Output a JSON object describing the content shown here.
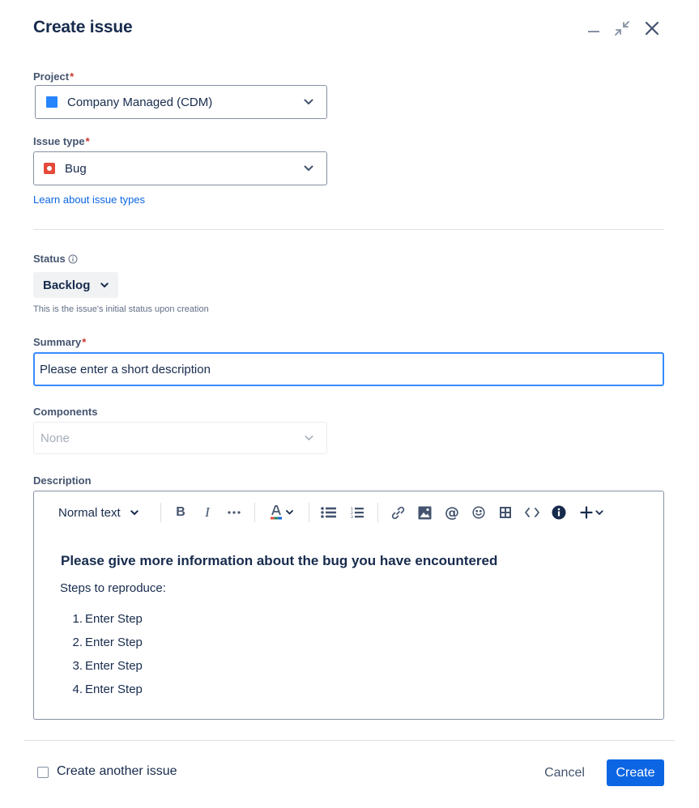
{
  "dialog": {
    "title": "Create issue",
    "header_icons": [
      "minimize-icon",
      "shrink-icon",
      "close-icon"
    ]
  },
  "project": {
    "label": "Project",
    "required_mark": "*",
    "value": "Company Managed (CDM)",
    "icon_color": "#2684ff"
  },
  "issue_type": {
    "label": "Issue type",
    "required_mark": "*",
    "value": "Bug",
    "icon_color": "#e5493a",
    "learn_link": "Learn about issue types"
  },
  "status": {
    "label": "Status",
    "value": "Backlog",
    "helper": "This is the issue's initial status upon creation"
  },
  "summary": {
    "label": "Summary",
    "required_mark": "*",
    "value": "Please enter a short description"
  },
  "components": {
    "label": "Components",
    "value": "None"
  },
  "description": {
    "label": "Description",
    "toolbar": {
      "text_style": "Normal text",
      "icons": [
        "bold-icon",
        "italic-icon",
        "more-formatting-icon",
        "text-color-icon",
        "bullet-list-icon",
        "numbered-list-icon",
        "link-icon",
        "image-icon",
        "mention-icon",
        "emoji-icon",
        "table-icon",
        "code-icon",
        "info-icon",
        "insert-plus-icon"
      ]
    },
    "heading": "Please give more information about the bug you have encountered",
    "intro": "Steps to reproduce:",
    "steps": [
      {
        "num": "1.",
        "text": "Enter Step"
      },
      {
        "num": "2.",
        "text": "Enter Step"
      },
      {
        "num": "3.",
        "text": "Enter Step"
      },
      {
        "num": "4.",
        "text": "Enter Step"
      }
    ]
  },
  "footer": {
    "create_another_label": "Create another issue",
    "create_another_checked": false,
    "cancel_label": "Cancel",
    "create_label": "Create"
  },
  "colors": {
    "primary": "#0c66e4",
    "text": "#172b4d",
    "required": "#c9372c",
    "focus_border": "#388bff"
  }
}
